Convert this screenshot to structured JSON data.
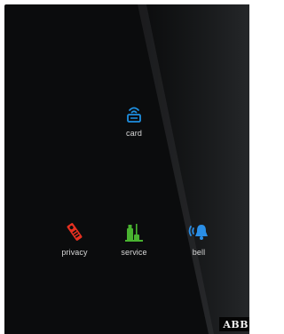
{
  "buttons": {
    "card": {
      "label": "card",
      "color": "#1e8fe0"
    },
    "privacy": {
      "label": "privacy",
      "color": "#e63020"
    },
    "service": {
      "label": "service",
      "color": "#49b330"
    },
    "bell": {
      "label": "bell",
      "color": "#2a8ee6"
    }
  },
  "brand": {
    "text": "ABB"
  }
}
